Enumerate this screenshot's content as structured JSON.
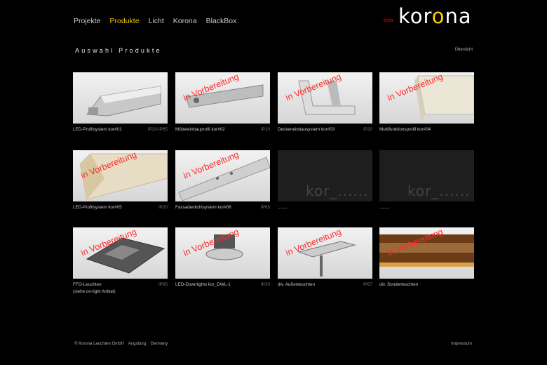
{
  "nav": {
    "items": [
      {
        "label": "Projekte",
        "active": false
      },
      {
        "label": "Produkte",
        "active": true
      },
      {
        "label": "Licht",
        "active": false
      },
      {
        "label": "Korona",
        "active": false
      },
      {
        "label": "BlackBox",
        "active": false
      }
    ]
  },
  "logo": {
    "beta": "beta",
    "text_a": "kor",
    "text_o": "o",
    "text_b": "na"
  },
  "page": {
    "title": "Auswahl Produkte",
    "overview_link": "Übersicht"
  },
  "stamp_text": "in Vorbereitung",
  "products": [
    {
      "name": "LED-Profilsystem kor#01",
      "ip": "IP20-IP65",
      "thumb": "light",
      "stamp": false,
      "image": "led-profile-icon"
    },
    {
      "name": "Möbeleinbauprofil  kor#02",
      "ip": "IP20",
      "thumb": "light",
      "stamp": true,
      "image": "furniture-profile-icon"
    },
    {
      "name": "Deckeneinbausystem kor#03",
      "ip": "IP20",
      "thumb": "light",
      "stamp": true,
      "image": "ceiling-profile-icon"
    },
    {
      "name": "Multifunktionsprofil  kor#04",
      "ip": "",
      "thumb": "light",
      "stamp": true,
      "image": "multi-profile-icon"
    },
    {
      "name": "LED-Profilsystem kor#05",
      "ip": "IP20",
      "thumb": "light",
      "stamp": true,
      "image": "led-profile2-icon"
    },
    {
      "name": "Fassadenlichtsystem kor#06",
      "ip": "IP65",
      "thumb": "light",
      "stamp": true,
      "image": "facade-profile-icon"
    },
    {
      "name": "........",
      "ip": "",
      "thumb": "dark",
      "stamp": false,
      "placeholder": "kor_......",
      "image": "placeholder-icon"
    },
    {
      "name": "........",
      "ip": "",
      "thumb": "dark",
      "stamp": false,
      "placeholder": "kor_......",
      "image": "placeholder-icon"
    },
    {
      "name": "FFO-Leuchten",
      "name2": "(siehe on-light Artikel)",
      "ip": "IP65",
      "thumb": "light",
      "stamp": true,
      "image": "ffo-luminaire-icon"
    },
    {
      "name": "LED-Downlights kor_DWL-1",
      "ip": "IP20",
      "thumb": "light",
      "stamp": true,
      "image": "downlight-icon"
    },
    {
      "name": "div. Außenleuchten",
      "ip": "IP67",
      "thumb": "light",
      "stamp": true,
      "image": "outdoor-luminaire-icon"
    },
    {
      "name": "div. Sonderleuchten",
      "ip": "",
      "thumb": "light",
      "stamp": true,
      "image": "special-luminaire-icon"
    }
  ],
  "footer": {
    "company": "© Korona Leuchten GmbH",
    "city": "Augsburg",
    "country": "Germany",
    "imprint": "Impressum"
  }
}
